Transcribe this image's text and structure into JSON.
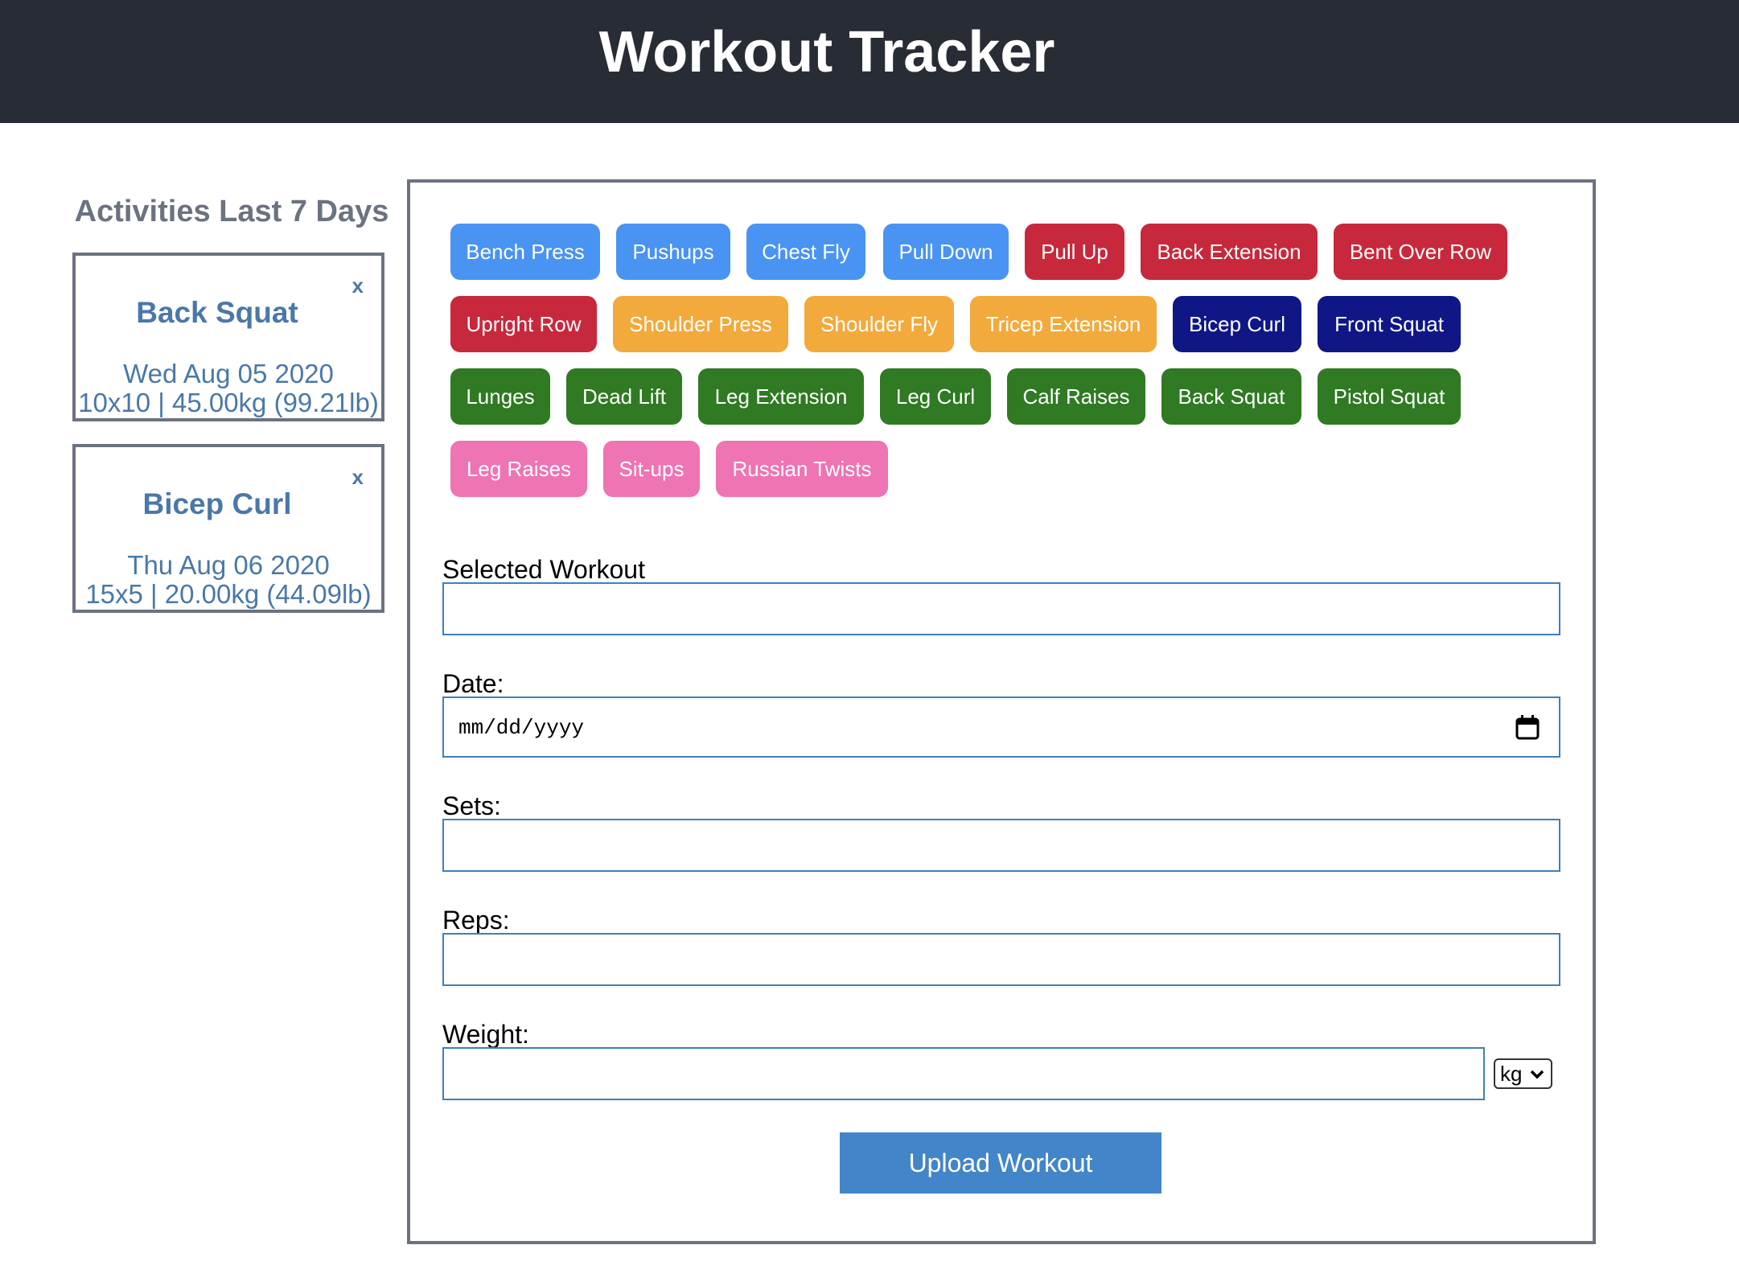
{
  "header": {
    "title": "Workout Tracker"
  },
  "sidebar": {
    "title": "Activities Last 7 Days",
    "close_label": "x",
    "activities": [
      {
        "name": "Back Squat",
        "date": "Wed Aug 05 2020",
        "detail": "10x10 | 45.00kg (99.21lb)"
      },
      {
        "name": "Bicep Curl",
        "date": "Thu Aug 06 2020",
        "detail": "15x5 | 20.00kg (44.09lb)"
      }
    ]
  },
  "workouts": [
    {
      "label": "Bench Press",
      "color": "#4993f3"
    },
    {
      "label": "Pushups",
      "color": "#4993f3"
    },
    {
      "label": "Chest Fly",
      "color": "#4993f3"
    },
    {
      "label": "Pull Down",
      "color": "#4993f3"
    },
    {
      "label": "Pull Up",
      "color": "#c8283c"
    },
    {
      "label": "Back Extension",
      "color": "#c8283c"
    },
    {
      "label": "Bent Over Row",
      "color": "#c8283c"
    },
    {
      "label": "Upright Row",
      "color": "#c8283c"
    },
    {
      "label": "Shoulder Press",
      "color": "#f2aa3c"
    },
    {
      "label": "Shoulder Fly",
      "color": "#f2aa3c"
    },
    {
      "label": "Tricep Extension",
      "color": "#f2aa3c"
    },
    {
      "label": "Bicep Curl",
      "color": "#0f1786"
    },
    {
      "label": "Front Squat",
      "color": "#0f1786"
    },
    {
      "label": "Lunges",
      "color": "#2f7a22"
    },
    {
      "label": "Dead Lift",
      "color": "#2f7a22"
    },
    {
      "label": "Leg Extension",
      "color": "#2f7a22"
    },
    {
      "label": "Leg Curl",
      "color": "#2f7a22"
    },
    {
      "label": "Calf Raises",
      "color": "#2f7a22"
    },
    {
      "label": "Back Squat",
      "color": "#2f7a22"
    },
    {
      "label": "Pistol Squat",
      "color": "#2f7a22"
    },
    {
      "label": "Leg Raises",
      "color": "#ee74b3"
    },
    {
      "label": "Sit-ups",
      "color": "#ee74b3"
    },
    {
      "label": "Russian Twists",
      "color": "#ee74b3"
    }
  ],
  "form": {
    "selected_workout_label": "Selected Workout",
    "selected_workout_value": "",
    "date_label": "Date:",
    "date_placeholder": "mm/dd/yyyy",
    "sets_label": "Sets:",
    "sets_value": "",
    "reps_label": "Reps:",
    "reps_value": "",
    "weight_label": "Weight:",
    "weight_value": "",
    "unit_selected": "kg",
    "upload_label": "Upload Workout"
  }
}
